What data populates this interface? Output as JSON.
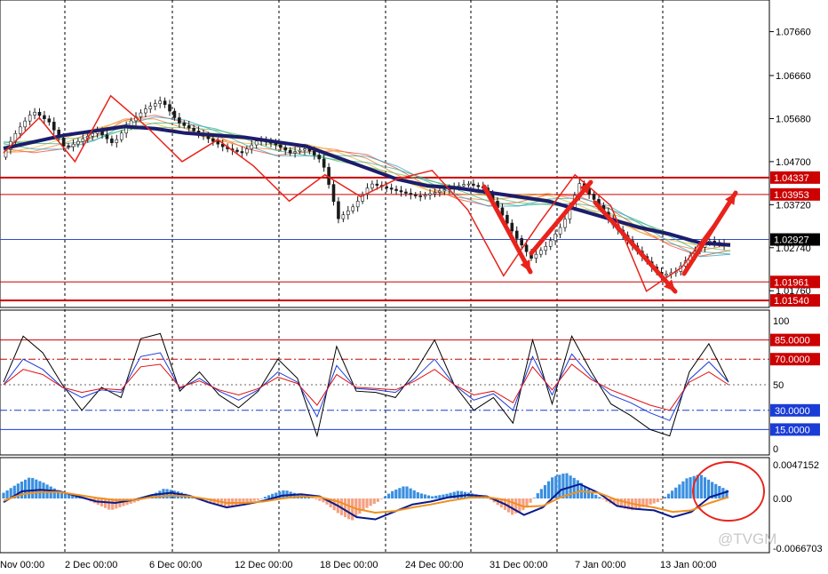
{
  "watermark": "@TVGM",
  "colors": {
    "price_line": "#cc0000",
    "current_line": "#3050c0",
    "annotation": "#e8231b",
    "ma_main": "#1c1c6e",
    "osc_black": "#000000",
    "osc_blue": "#1a3cd6",
    "osc_red": "#e01010",
    "hist_pos": "#3a8fe0",
    "hist_neg": "#f5a080",
    "macd_line": "#0a1a8c",
    "signal_line": "#f0901e"
  },
  "chart_data": [
    {
      "type": "candlestick",
      "title": "",
      "yticks": [
        "1.07660",
        "1.06660",
        "1.05680",
        "1.04700",
        "1.03720",
        "1.02740",
        "1.01760"
      ],
      "ylim": [
        1.0138,
        1.0838
      ],
      "x_labels": [
        "Nov 00:00",
        "2 Dec 00:00",
        "6 Dec 00:00",
        "12 Dec 00:00",
        "18 Dec 00:00",
        "24 Dec 00:00",
        "31 Dec 00:00",
        "7 Jan 00:00",
        "13 Jan 00:00"
      ],
      "close_path": [
        1.048,
        1.054,
        1.0585,
        1.056,
        1.05,
        1.052,
        1.054,
        1.051,
        1.056,
        1.059,
        1.061,
        1.056,
        1.054,
        1.052,
        1.05,
        1.049,
        1.052,
        1.051,
        1.049,
        1.05,
        1.047,
        1.034,
        1.037,
        1.042,
        1.041,
        1.04,
        1.039,
        1.04,
        1.041,
        1.042,
        1.041,
        1.036,
        1.03,
        1.025,
        1.028,
        1.033,
        1.042,
        1.038,
        1.033,
        1.029,
        1.025,
        1.021,
        1.022,
        1.026,
        1.029,
        1.028
      ],
      "ma_path": [
        1.05,
        1.0515,
        1.053,
        1.054,
        1.055,
        1.0545,
        1.0535,
        1.053,
        1.0525,
        1.0515,
        1.0505,
        1.048,
        1.0455,
        1.043,
        1.0415,
        1.041,
        1.04,
        1.039,
        1.038,
        1.036,
        1.034,
        1.032,
        1.0305,
        1.0285,
        1.028
      ],
      "horizontal_levels": [
        {
          "label": "1.04337",
          "value": 1.04337,
          "style": "red-bold"
        },
        {
          "label": "1.03953",
          "value": 1.03953,
          "style": "red"
        },
        {
          "label": "1.02927",
          "value": 1.02927,
          "style": "current"
        },
        {
          "label": "1.01961",
          "value": 1.01961,
          "style": "red"
        },
        {
          "label": "1.01540",
          "value": 1.0154,
          "style": "red-bold"
        }
      ],
      "zigzag": [
        1.049,
        1.057,
        1.047,
        1.062,
        1.055,
        1.047,
        1.052,
        1.046,
        1.038,
        1.044,
        1.039,
        1.043,
        1.045,
        1.036,
        1.021,
        1.033,
        1.044,
        1.037,
        1.0175,
        1.023,
        1.034
      ]
    },
    {
      "type": "line",
      "title": "",
      "yticks": [
        "100",
        "50",
        "0"
      ],
      "ylim": [
        0,
        100
      ],
      "levels": [
        {
          "label": "85.0000",
          "value": 85,
          "style": "solid-red"
        },
        {
          "label": "70.0000",
          "value": 70,
          "style": "dashdot-red"
        },
        {
          "label": "30.0000",
          "value": 30,
          "style": "dashdot-blue"
        },
        {
          "label": "15.0000",
          "value": 15,
          "style": "solid-blue"
        }
      ],
      "series": [
        {
          "values": [
            52,
            88,
            75,
            50,
            30,
            48,
            40,
            86,
            90,
            45,
            60,
            42,
            32,
            45,
            70,
            55,
            10,
            80,
            45,
            44,
            40,
            60,
            85,
            50,
            30,
            40,
            20,
            85,
            35,
            88,
            60,
            35,
            26,
            15,
            10,
            60,
            82,
            52
          ]
        },
        {
          "values": [
            50,
            70,
            62,
            48,
            40,
            46,
            44,
            72,
            75,
            47,
            55,
            45,
            38,
            46,
            60,
            52,
            25,
            65,
            47,
            46,
            44,
            55,
            70,
            50,
            38,
            43,
            30,
            72,
            42,
            74,
            56,
            42,
            36,
            28,
            22,
            54,
            68,
            52
          ]
        },
        {
          "values": [
            50,
            62,
            58,
            48,
            44,
            47,
            46,
            64,
            66,
            48,
            53,
            46,
            42,
            47,
            56,
            51,
            34,
            58,
            48,
            47,
            46,
            53,
            62,
            50,
            42,
            45,
            36,
            64,
            46,
            66,
            54,
            46,
            40,
            34,
            30,
            52,
            60,
            50
          ]
        }
      ]
    },
    {
      "type": "bar",
      "title": "",
      "yticks": [
        "0.0047152",
        "0.00",
        "-0.0066703"
      ],
      "ylim": [
        -0.0066703,
        0.0047152
      ],
      "histogram": [
        0.0008,
        0.002,
        0.003,
        0.0022,
        0.0012,
        0.0005,
        0.0,
        -0.0008,
        -0.0016,
        -0.001,
        -0.0004,
        0.0004,
        0.0014,
        0.001,
        0.0004,
        -0.0002,
        -0.0008,
        -0.0012,
        -0.0006,
        -0.0002,
        0.0006,
        0.0012,
        0.0006,
        0.0001,
        -0.0006,
        -0.002,
        -0.003,
        -0.0014,
        -0.0004,
        0.001,
        0.0018,
        0.0008,
        0.0003,
        0.0006,
        0.0011,
        0.0007,
        0.0003,
        -0.001,
        -0.0022,
        -0.0014,
        0.001,
        0.003,
        0.0036,
        0.0024,
        0.0008,
        -0.0004,
        -0.0012,
        -0.0016,
        -0.001,
        -0.0004,
        0.0012,
        0.0028,
        0.0034,
        0.0022,
        0.0012
      ],
      "macd": [
        -0.0005,
        0.001,
        0.0012,
        0.001,
        0.0003,
        -0.0004,
        -0.0006,
        -0.0002,
        0.0005,
        0.0008,
        0.0004,
        -0.0005,
        -0.0012,
        -0.0008,
        -0.0003,
        0.0004,
        0.0006,
        0.0003,
        -0.001,
        -0.0025,
        -0.0028,
        -0.0018,
        -0.0008,
        -0.0004,
        0.0002,
        0.0005,
        0.0003,
        -0.0008,
        -0.0022,
        -0.0012,
        0.0012,
        0.002,
        0.0008,
        -0.001,
        -0.0014,
        -0.0016,
        -0.0025,
        -0.0018,
        0.0002,
        0.001
      ],
      "signal": [
        -0.0003,
        0.0006,
        0.0009,
        0.0009,
        0.0005,
        0.0001,
        -0.0002,
        -0.0002,
        0.0002,
        0.0004,
        0.0003,
        -0.0001,
        -0.0006,
        -0.0006,
        -0.0004,
        0.0,
        0.0003,
        0.0002,
        -0.0004,
        -0.0014,
        -0.0019,
        -0.0017,
        -0.0012,
        -0.0008,
        -0.0003,
        0.0001,
        0.0002,
        -0.0002,
        -0.0011,
        -0.001,
        0.0002,
        0.001,
        0.0008,
        -0.0002,
        -0.0008,
        -0.0012,
        -0.0018,
        -0.0016,
        -0.0006,
        0.0002
      ]
    }
  ]
}
